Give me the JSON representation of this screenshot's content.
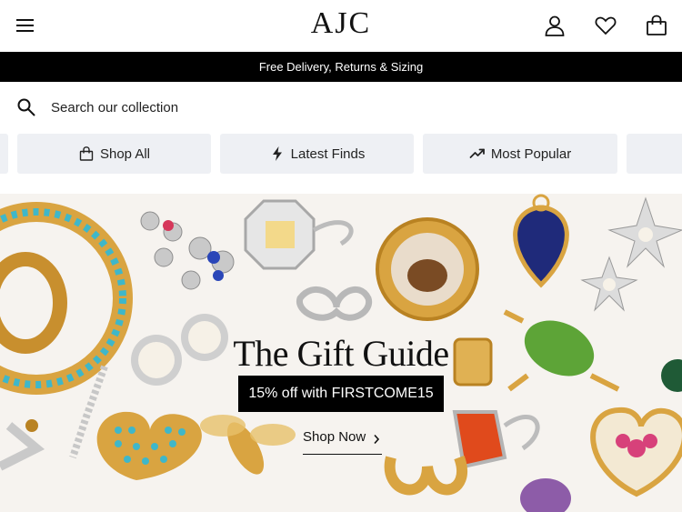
{
  "header": {
    "logo": "AJC",
    "icons": [
      "menu-icon",
      "account-icon",
      "wishlist-icon",
      "bag-icon"
    ]
  },
  "promo_bar": {
    "text": "Free Delivery, Returns & Sizing"
  },
  "search": {
    "placeholder": "Search our collection"
  },
  "categories": [
    {
      "label": "Shop All",
      "icon": "bag-icon"
    },
    {
      "label": "Latest Finds",
      "icon": "lightning-icon"
    },
    {
      "label": "Most Popular",
      "icon": "trending-icon"
    }
  ],
  "hero": {
    "title": "The Gift Guide",
    "promo_code": "15% off with FIRSTCOME15",
    "cta_label": "Shop Now"
  },
  "colors": {
    "accent": "#000000",
    "chip_bg": "#eef0f4",
    "gold": "#d9a441",
    "turquoise": "#3fb7c9"
  }
}
